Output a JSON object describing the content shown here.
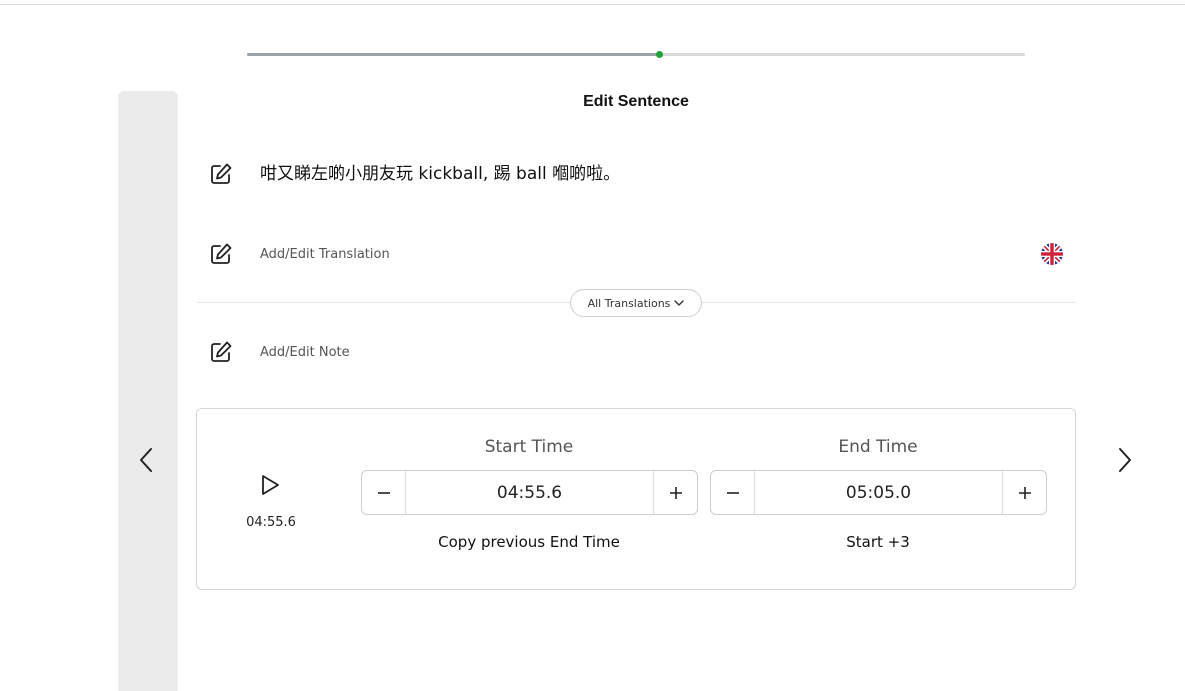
{
  "progress": {
    "fraction": 0.53
  },
  "editor": {
    "title": "Edit Sentence",
    "sentence": "咁又睇左啲小朋友玩 kickball, 踢 ball 嗰啲啦。",
    "translation_placeholder": "Add/Edit Translation",
    "all_translations_label": "All Translations",
    "note_placeholder": "Add/Edit Note"
  },
  "player": {
    "current_time": "04:55.6"
  },
  "start_time": {
    "label": "Start Time",
    "value": "04:55.6",
    "action": "Copy previous End Time"
  },
  "end_time": {
    "label": "End Time",
    "value": "05:05.0",
    "action": "Start +3"
  },
  "icons": {
    "prev": "chevron-left-icon",
    "next": "chevron-right-icon",
    "edit": "edit-icon",
    "play": "play-icon",
    "flag": "uk-flag-icon",
    "dropdown": "chevron-down-icon"
  },
  "colors": {
    "progress_dot": "#22a33a",
    "panel": "#ebebeb"
  }
}
